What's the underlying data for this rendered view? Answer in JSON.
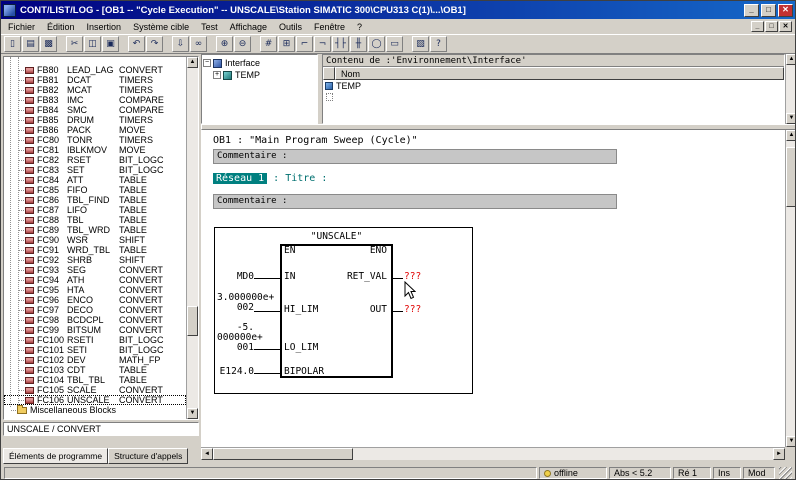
{
  "window": {
    "title": "CONT/LIST/LOG - [OB1 -- \"Cycle Execution\" -- UNSCALE\\Station SIMATIC 300\\CPU313 C(1)\\...\\OB1]"
  },
  "icons": {
    "up": "▲",
    "down": "▼",
    "left": "◄",
    "right": "►",
    "minimize": "_",
    "maximize": "□",
    "close": "✕",
    "collapse": "−",
    "expand": "+"
  },
  "menu": {
    "items": [
      "Fichier",
      "Édition",
      "Insertion",
      "Système cible",
      "Test",
      "Affichage",
      "Outils",
      "Fenêtre",
      "?"
    ]
  },
  "toolbar": {
    "buttons": [
      {
        "name": "new-document-icon",
        "glyph": "▯"
      },
      {
        "name": "open-icon",
        "glyph": "▤"
      },
      {
        "name": "print-icon",
        "glyph": "▩"
      },
      {
        "name": "cut-icon",
        "glyph": "✂",
        "gap": true
      },
      {
        "name": "copy-icon",
        "glyph": "◫"
      },
      {
        "name": "paste-icon",
        "glyph": "▣"
      },
      {
        "name": "undo-icon",
        "glyph": "↶",
        "gap": true
      },
      {
        "name": "redo-icon",
        "glyph": "↷"
      },
      {
        "name": "download-icon",
        "glyph": "⇩",
        "gap": true
      },
      {
        "name": "monitor-glasses-icon",
        "glyph": "∞"
      },
      {
        "name": "zoom-in-icon",
        "glyph": "⊕",
        "gap": true
      },
      {
        "name": "zoom-out-icon",
        "glyph": "⊖"
      },
      {
        "name": "address-symbols-icon",
        "glyph": "#",
        "gap": true
      },
      {
        "name": "new-network-icon",
        "glyph": "⊞"
      },
      {
        "name": "open-branch-icon",
        "glyph": "⌐"
      },
      {
        "name": "close-branch-icon",
        "glyph": "¬"
      },
      {
        "name": "contact-no-icon",
        "glyph": "┤├"
      },
      {
        "name": "contact-nc-icon",
        "glyph": "╫"
      },
      {
        "name": "coil-icon",
        "glyph": "◯"
      },
      {
        "name": "empty-box-icon",
        "glyph": "▭"
      },
      {
        "name": "catalog-icon",
        "glyph": "▧",
        "gap": true
      },
      {
        "name": "help-icon",
        "glyph": "?"
      }
    ]
  },
  "tree": {
    "items": [
      {
        "id": "FB80",
        "name": "LEAD_LAG",
        "cat": "CONVERT"
      },
      {
        "id": "FB81",
        "name": "DCAT",
        "cat": "TIMERS"
      },
      {
        "id": "FB82",
        "name": "MCAT",
        "cat": "TIMERS"
      },
      {
        "id": "FB83",
        "name": "IMC",
        "cat": "COMPARE"
      },
      {
        "id": "FB84",
        "name": "SMC",
        "cat": "COMPARE"
      },
      {
        "id": "FB85",
        "name": "DRUM",
        "cat": "TIMERS"
      },
      {
        "id": "FB86",
        "name": "PACK",
        "cat": "MOVE"
      },
      {
        "id": "FC80",
        "name": "TONR",
        "cat": "TIMERS"
      },
      {
        "id": "FC81",
        "name": "IBLKMOV",
        "cat": "MOVE"
      },
      {
        "id": "FC82",
        "name": "RSET",
        "cat": "BIT_LOGC"
      },
      {
        "id": "FC83",
        "name": "SET",
        "cat": "BIT_LOGC"
      },
      {
        "id": "FC84",
        "name": "ATT",
        "cat": "TABLE"
      },
      {
        "id": "FC85",
        "name": "FIFO",
        "cat": "TABLE"
      },
      {
        "id": "FC86",
        "name": "TBL_FIND",
        "cat": "TABLE"
      },
      {
        "id": "FC87",
        "name": "LIFO",
        "cat": "TABLE"
      },
      {
        "id": "FC88",
        "name": "TBL",
        "cat": "TABLE"
      },
      {
        "id": "FC89",
        "name": "TBL_WRD",
        "cat": "TABLE"
      },
      {
        "id": "FC90",
        "name": "WSR",
        "cat": "SHIFT"
      },
      {
        "id": "FC91",
        "name": "WRD_TBL",
        "cat": "TABLE"
      },
      {
        "id": "FC92",
        "name": "SHRB",
        "cat": "SHIFT"
      },
      {
        "id": "FC93",
        "name": "SEG",
        "cat": "CONVERT"
      },
      {
        "id": "FC94",
        "name": "ATH",
        "cat": "CONVERT"
      },
      {
        "id": "FC95",
        "name": "HTA",
        "cat": "CONVERT"
      },
      {
        "id": "FC96",
        "name": "ENCO",
        "cat": "CONVERT"
      },
      {
        "id": "FC97",
        "name": "DECO",
        "cat": "CONVERT"
      },
      {
        "id": "FC98",
        "name": "BCDCPL",
        "cat": "CONVERT"
      },
      {
        "id": "FC99",
        "name": "BITSUM",
        "cat": "CONVERT"
      },
      {
        "id": "FC100",
        "name": "RSETI",
        "cat": "BIT_LOGC"
      },
      {
        "id": "FC101",
        "name": "SETI",
        "cat": "BIT_LOGC"
      },
      {
        "id": "FC102",
        "name": "DEV",
        "cat": "MATH_FP"
      },
      {
        "id": "FC103",
        "name": "CDT",
        "cat": "TABLE"
      },
      {
        "id": "FC104",
        "name": "TBL_TBL",
        "cat": "TABLE"
      },
      {
        "id": "FC105",
        "name": "SCALE",
        "cat": "CONVERT"
      },
      {
        "id": "FC106",
        "name": "UNSCALE",
        "cat": "CONVERT"
      }
    ],
    "misc_label": "Miscellaneous Blocks",
    "description": "UNSCALE / CONVERT"
  },
  "tabs": {
    "tab1": "Éléments de programme",
    "tab2": "Structure d'appels"
  },
  "decl": {
    "header": "Contenu de :'Environnement\\Interface'",
    "root": "Interface",
    "child": "TEMP",
    "col": "Nom",
    "row": "TEMP"
  },
  "editor": {
    "ob1_header": "OB1 :  \"Main Program Sweep (Cycle)\"",
    "comment1": "Commentaire :",
    "network_label": "Réseau 1",
    "network_title": ": Titre :",
    "comment2": "Commentaire :",
    "block": {
      "title": "\"UNSCALE\"",
      "en": "EN",
      "eno": "ENO",
      "in_pin": "IN",
      "in_operand": "MD0",
      "hi_pin": "HI_LIM",
      "hi_operand": "3.000000e+\n002",
      "lo_pin": "LO_LIM",
      "lo_operand": "-5.\n000000e+\n001",
      "bip_pin": "BIPOLAR",
      "bip_operand": "E124.0",
      "ret_pin": "RET_VAL",
      "ret_value": "???",
      "out_pin": "OUT",
      "out_value": "???"
    }
  },
  "statusbar": {
    "connection": "offline",
    "abs": "Abs < 5.2",
    "network": "Ré 1",
    "ins": "Ins",
    "mod": "Mod"
  },
  "colors": {
    "titlebar": "#000080",
    "network_select": "#008080",
    "error_value": "#e00000",
    "window_bg": "#d4d0c8"
  }
}
